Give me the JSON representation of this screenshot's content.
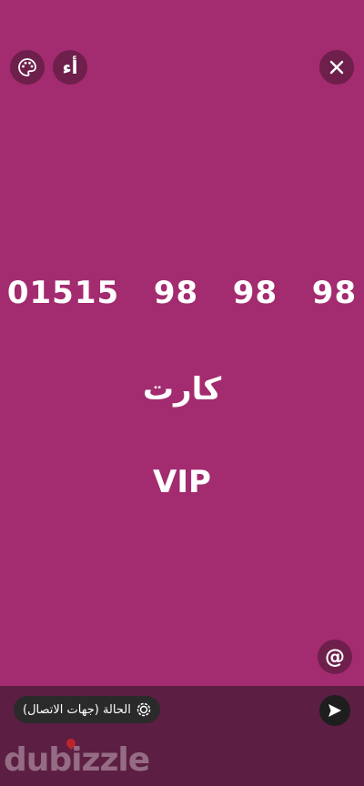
{
  "top_controls": {
    "palette_icon": "palette-icon",
    "font_label": "أء",
    "close_icon": "close-icon"
  },
  "status": {
    "line1": "01515  98  98  98",
    "line2": "كارت",
    "line3": "VIP"
  },
  "mention_symbol": "@",
  "bottom": {
    "audience_label": "الحالة (جهات الاتصال)",
    "send_icon": "send-icon"
  },
  "watermark": "dubizzle",
  "colors": {
    "background": "#a32b6f",
    "bottom_bar": "#5c1e42"
  }
}
